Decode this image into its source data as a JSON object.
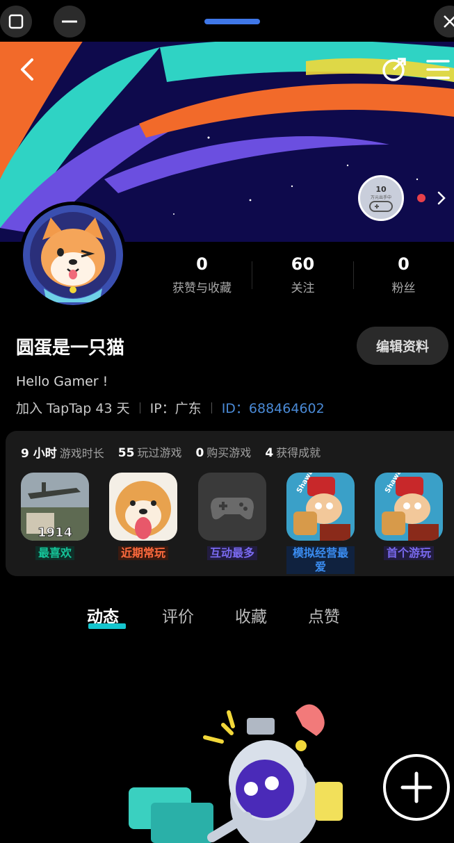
{
  "banner_badge": {
    "number": "10",
    "caption": "万元出手中"
  },
  "profile": {
    "name": "圆蛋是一只猫",
    "bio": "Hello Gamer !",
    "joined": "加入 TapTap 43 天",
    "ip": "IP：广东",
    "id": "ID：688464602",
    "edit_label": "编辑资料"
  },
  "stats": [
    {
      "value": "0",
      "label": "获赞与收藏"
    },
    {
      "value": "60",
      "label": "关注"
    },
    {
      "value": "0",
      "label": "粉丝"
    }
  ],
  "summary": [
    {
      "value": "9 小时",
      "label": "游戏时长"
    },
    {
      "value": "55",
      "label": "玩过游戏"
    },
    {
      "value": "0",
      "label": "购买游戏"
    },
    {
      "value": "4",
      "label": "获得成就"
    }
  ],
  "games": [
    {
      "tag": "最喜欢",
      "tag_color": "#15c59a",
      "icon_text": "1914"
    },
    {
      "tag": "近期常玩",
      "tag_color": "#ff6a3d"
    },
    {
      "tag": "互动最多",
      "tag_color": "#6a5ae0"
    },
    {
      "tag": "模拟经营最爱",
      "tag_color": "#3a8cf0",
      "icon_text": "Shawarma"
    },
    {
      "tag": "首个游玩",
      "tag_color": "#6a5ae0",
      "icon_text": "Shawarma"
    }
  ],
  "tabs": [
    "动态",
    "评价",
    "收藏",
    "点赞"
  ],
  "colors": {
    "accent": "#15c5ce",
    "id_blue": "#4a8ad6",
    "badge_red": "#e8404a"
  }
}
